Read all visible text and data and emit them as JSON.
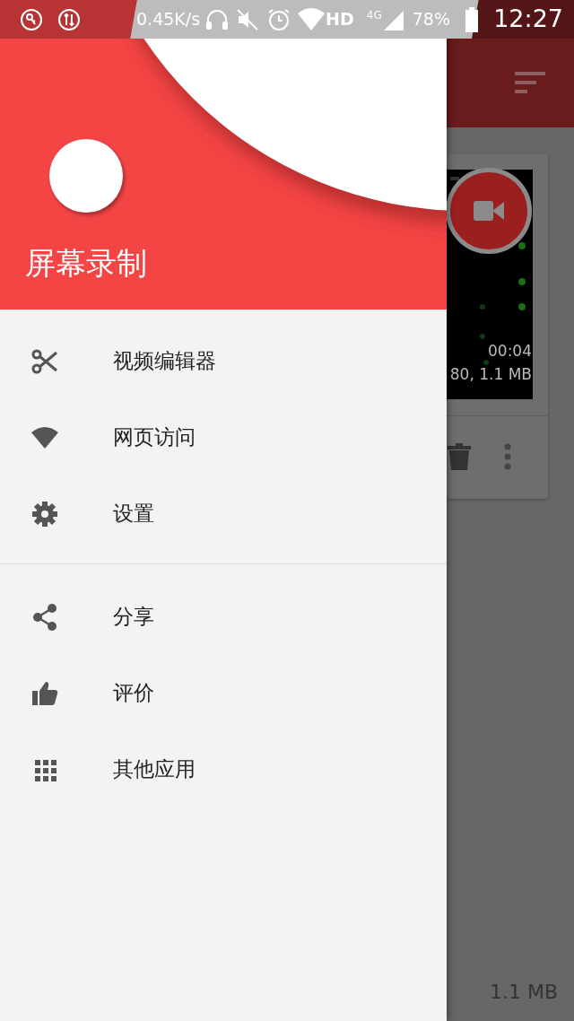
{
  "status_bar": {
    "net_speed": "0.45K/s",
    "hd": "HD",
    "network_type": "4G",
    "battery": "78%",
    "time": "12:27"
  },
  "drawer": {
    "title": "屏幕录制",
    "sections": [
      {
        "items": [
          {
            "kind": "scissors",
            "label": "视频编辑器"
          },
          {
            "kind": "wifi",
            "label": "网页访问"
          },
          {
            "kind": "gear",
            "label": "设置"
          }
        ]
      },
      {
        "items": [
          {
            "kind": "share",
            "label": "分享"
          },
          {
            "kind": "thumb",
            "label": "评价"
          },
          {
            "kind": "grid",
            "label": "其他应用"
          }
        ]
      }
    ]
  },
  "background_app": {
    "recording": {
      "duration": "00:04",
      "details": "80, 1.1 MB"
    },
    "footer_size": "1.1 MB"
  }
}
